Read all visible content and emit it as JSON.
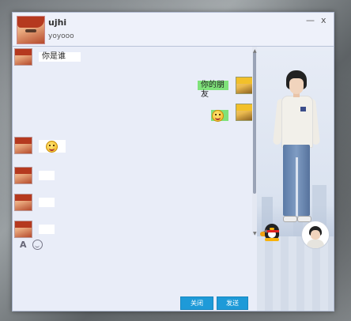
{
  "window": {
    "nickname": "ujhi",
    "signature": "yoyooo",
    "controls": {
      "minimize": "—",
      "close": "x"
    }
  },
  "messages": [
    {
      "side": "left",
      "avatar": "red-hair-avatar",
      "text": "你是谁"
    },
    {
      "side": "right",
      "avatar": "naruto-avatar",
      "text": "你的朋友"
    },
    {
      "side": "right",
      "avatar": "naruto-avatar",
      "text": "",
      "emoji": "smile-emoji"
    },
    {
      "side": "left",
      "avatar": "red-hair-avatar",
      "text": "",
      "emoji": "smile-emoji"
    },
    {
      "side": "left",
      "avatar": "red-hair-avatar",
      "text": ""
    },
    {
      "side": "left",
      "avatar": "red-hair-avatar",
      "text": ""
    },
    {
      "side": "left",
      "avatar": "red-hair-avatar",
      "text": ""
    }
  ],
  "toolbar": {
    "font_icon": "A",
    "face_icon": "smile-icon"
  },
  "buttons": {
    "close": "关闭",
    "send": "发送"
  },
  "scroll": {
    "up_arrow": "▲",
    "down_arrow": "▼"
  },
  "side_panel": {
    "avatar_arrow": "◀"
  },
  "colors": {
    "accent": "#1e9ad8",
    "own_bubble": "#7fe27a",
    "window_bg": "#e9edf8"
  }
}
